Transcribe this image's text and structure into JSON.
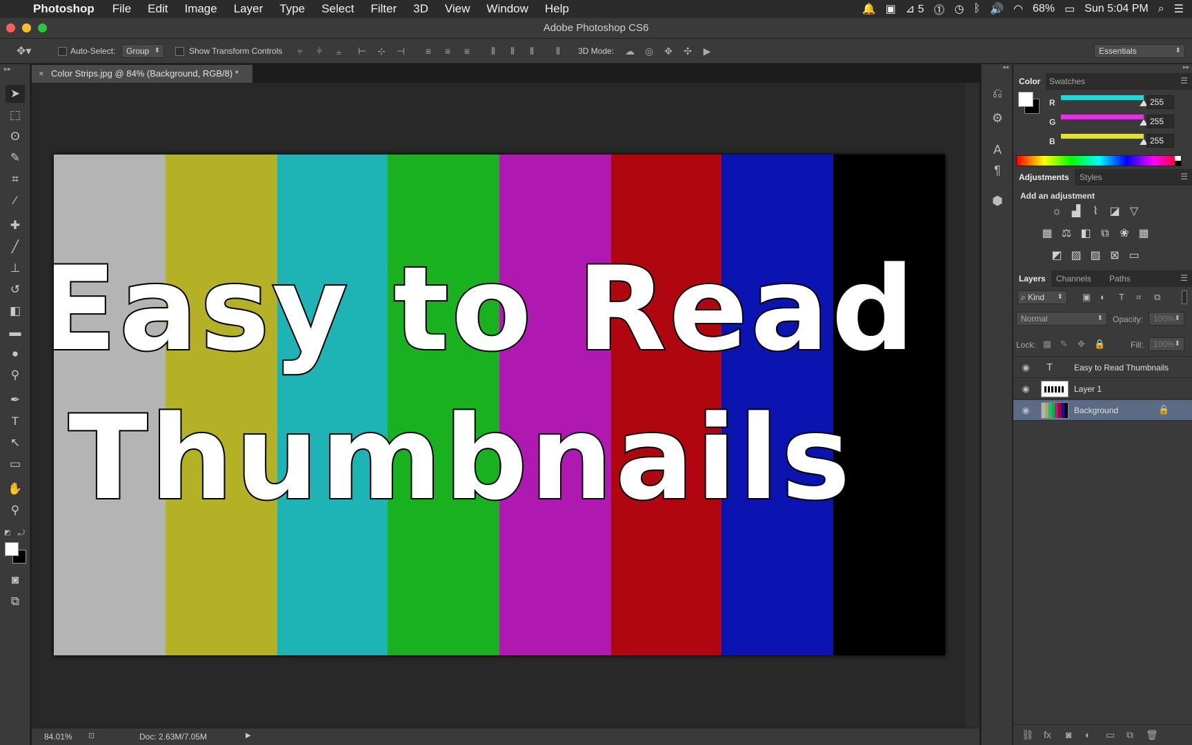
{
  "menubar": {
    "apple_icon": "",
    "app_name": "Photoshop",
    "items": [
      "File",
      "Edit",
      "Image",
      "Layer",
      "Type",
      "Select",
      "Filter",
      "3D",
      "View",
      "Window",
      "Help"
    ],
    "status": {
      "badge_count": "5",
      "battery": "68%",
      "clock": "Sun 5:04 PM"
    }
  },
  "window": {
    "title": "Adobe Photoshop CS6"
  },
  "options": {
    "auto_select_label": "Auto-Select:",
    "auto_select_value": "Group",
    "show_transform_label": "Show Transform Controls",
    "mode3d_label": "3D Mode:",
    "workspace_value": "Essentials"
  },
  "document": {
    "tab_title": "Color Strips.jpg @ 84% (Background, RGB/8) *",
    "line1": "Easy to Read",
    "line2": "Thumbnails",
    "strip_colors": [
      "#b4b4b4",
      "#b5b126",
      "#1eb3b4",
      "#1ab120",
      "#b019b1",
      "#b0060f",
      "#0b14b0",
      "#000000"
    ]
  },
  "statusbar": {
    "zoom": "84.01%",
    "doc_size": "Doc: 2.63M/7.05M"
  },
  "color_panel": {
    "tabs": [
      "Color",
      "Swatches"
    ],
    "channels": [
      {
        "label": "R",
        "value": "255",
        "color": "#22d8d8"
      },
      {
        "label": "G",
        "value": "255",
        "color": "#e033e0"
      },
      {
        "label": "B",
        "value": "255",
        "color": "#e0e030"
      }
    ]
  },
  "adjustments_panel": {
    "tabs": [
      "Adjustments",
      "Styles"
    ],
    "heading": "Add an adjustment"
  },
  "layers_panel": {
    "tabs": [
      "Layers",
      "Channels",
      "Paths"
    ],
    "filter_value": "Kind",
    "blend_mode": "Normal",
    "opacity_label": "Opacity:",
    "opacity_value": "100%",
    "lock_label": "Lock:",
    "fill_label": "Fill:",
    "fill_value": "100%",
    "layers": [
      {
        "name": "Easy to Read Thumbnails",
        "type": "text"
      },
      {
        "name": "Layer 1",
        "type": "pixel"
      },
      {
        "name": "Background",
        "type": "background",
        "selected": true
      }
    ]
  }
}
